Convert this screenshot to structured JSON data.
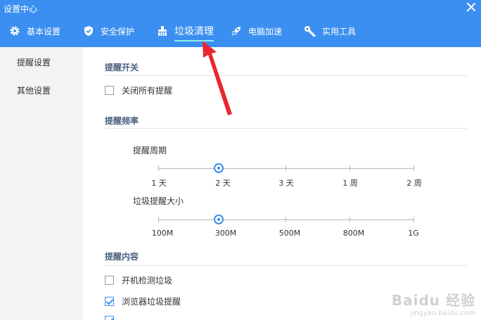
{
  "window": {
    "title": "设置中心"
  },
  "tabs": [
    {
      "label": "基本设置",
      "icon": "gear-icon"
    },
    {
      "label": "安全保护",
      "icon": "shield-icon"
    },
    {
      "label": "垃圾清理",
      "icon": "broom-icon",
      "active": true
    },
    {
      "label": "电脑加速",
      "icon": "rocket-icon"
    },
    {
      "label": "实用工具",
      "icon": "wrench-icon"
    }
  ],
  "sidebar": {
    "items": [
      {
        "label": "提醒设置",
        "active": true
      },
      {
        "label": "其他设置"
      }
    ]
  },
  "sections": {
    "switch": {
      "title": "提醒开关",
      "close_all": {
        "label": "关闭所有提醒",
        "checked": false
      }
    },
    "frequency": {
      "title": "提醒频率",
      "period": {
        "label": "提醒周期",
        "options": [
          "1 天",
          "2 天",
          "3 天",
          "1 周",
          "2 周"
        ],
        "selected": "2 天"
      },
      "size": {
        "label": "垃圾提醒大小",
        "options": [
          "100M",
          "300M",
          "500M",
          "800M",
          "1G"
        ],
        "selected": "300M"
      }
    },
    "content": {
      "title": "提醒内容",
      "items": [
        {
          "label": "开机检测垃圾",
          "checked": false
        },
        {
          "label": "浏览器垃圾提醒",
          "checked": true
        },
        {
          "label": "",
          "checked": true
        }
      ]
    }
  },
  "watermark": {
    "logo": "Baidu 经验",
    "url": "jingyan.baidu.com"
  },
  "colors": {
    "accent": "#3b8ff0",
    "annotation": "#e8262f"
  }
}
